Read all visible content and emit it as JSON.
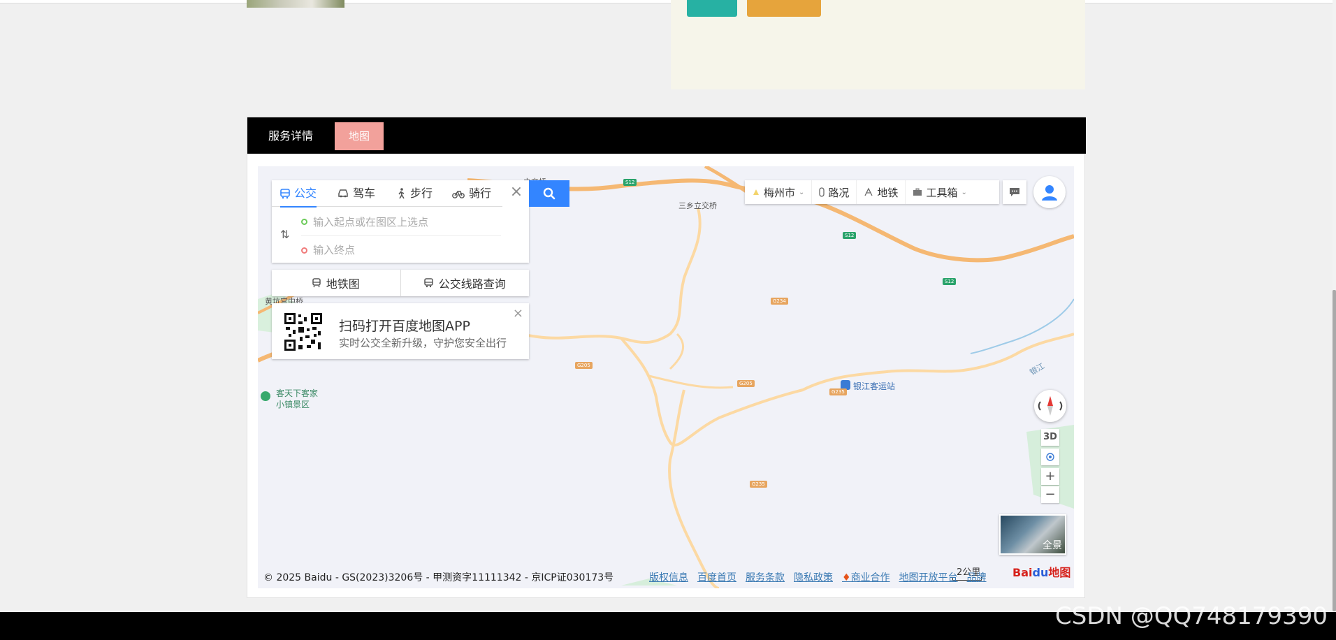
{
  "tabs": {
    "details": "服务详情",
    "map": "地图"
  },
  "route": {
    "modes": [
      "公交",
      "驾车",
      "步行",
      "骑行"
    ],
    "start_placeholder": "输入起点或在图区上选点",
    "end_placeholder": "输入终点"
  },
  "sub_buttons": {
    "subway_map": "地铁图",
    "bus_line": "公交线路查询"
  },
  "qr": {
    "title": "扫码打开百度地图APP",
    "subtitle": "实时公交全新升级，守护您安全出行"
  },
  "toolbar": {
    "city": "梅州市",
    "traffic": "路况",
    "subway": "地铁",
    "toolbox": "工具箱"
  },
  "controls": {
    "three_d": "3D",
    "pano": "全景",
    "scale": "2公里"
  },
  "map_labels": {
    "interchange1": "三乡立交桥",
    "interchange2": "立交桥",
    "interchange2b": "交",
    "bridge": "黄坑宫中桥",
    "poi1_a": "客天下客家",
    "poi1_b": "小镇景区",
    "bus_station": "银江客运站",
    "river": "银江",
    "roads": [
      "S12",
      "S12",
      "S12",
      "G234",
      "G205",
      "G205",
      "G235",
      "G235"
    ]
  },
  "footer": {
    "copyright": "© 2025 Baidu - GS(2023)3206号 - 甲测资字11111342 - 京ICP证030173号",
    "links": [
      "版权信息",
      "百度首页",
      "服务条款",
      "隐私政策",
      "商业合作",
      "地图开放平台",
      "品牌"
    ],
    "logo_a": "Bai",
    "logo_b": "du",
    "logo_c": "地图"
  },
  "watermark": "CSDN @QQ748179390",
  "colors": {
    "accent": "#3385ff",
    "tab_active": "#f2a19b",
    "road": "#f5b873",
    "road_minor": "#fcd9a3"
  }
}
